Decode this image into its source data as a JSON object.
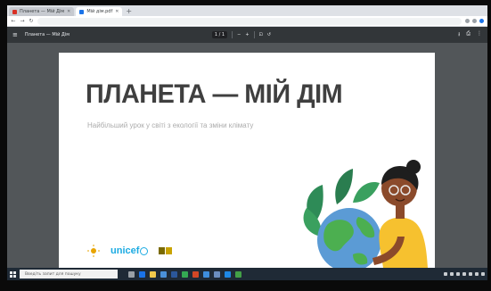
{
  "browser": {
    "tabs": [
      {
        "label": "Планета — Мій Дім",
        "active": false
      },
      {
        "label": "Мій дім.pdf",
        "active": true
      }
    ],
    "url": "",
    "new_tab": "+"
  },
  "pdf_viewer": {
    "title": "Планета — Мій Дім",
    "page": "1 / 1"
  },
  "document": {
    "heading": "ПЛАНЕТА — МІЙ ДІМ",
    "subheading": "Найбільший урок у світі з екології та зміни клімату",
    "logo_unicef": "unicef"
  },
  "taskbar": {
    "search_placeholder": "Введіть запит для пошуку"
  },
  "colors": {
    "unicef": "#1cabe2",
    "heading": "#3f3f3f",
    "taskbar": "#1f2a36",
    "pdf_toolbar": "#323639"
  }
}
